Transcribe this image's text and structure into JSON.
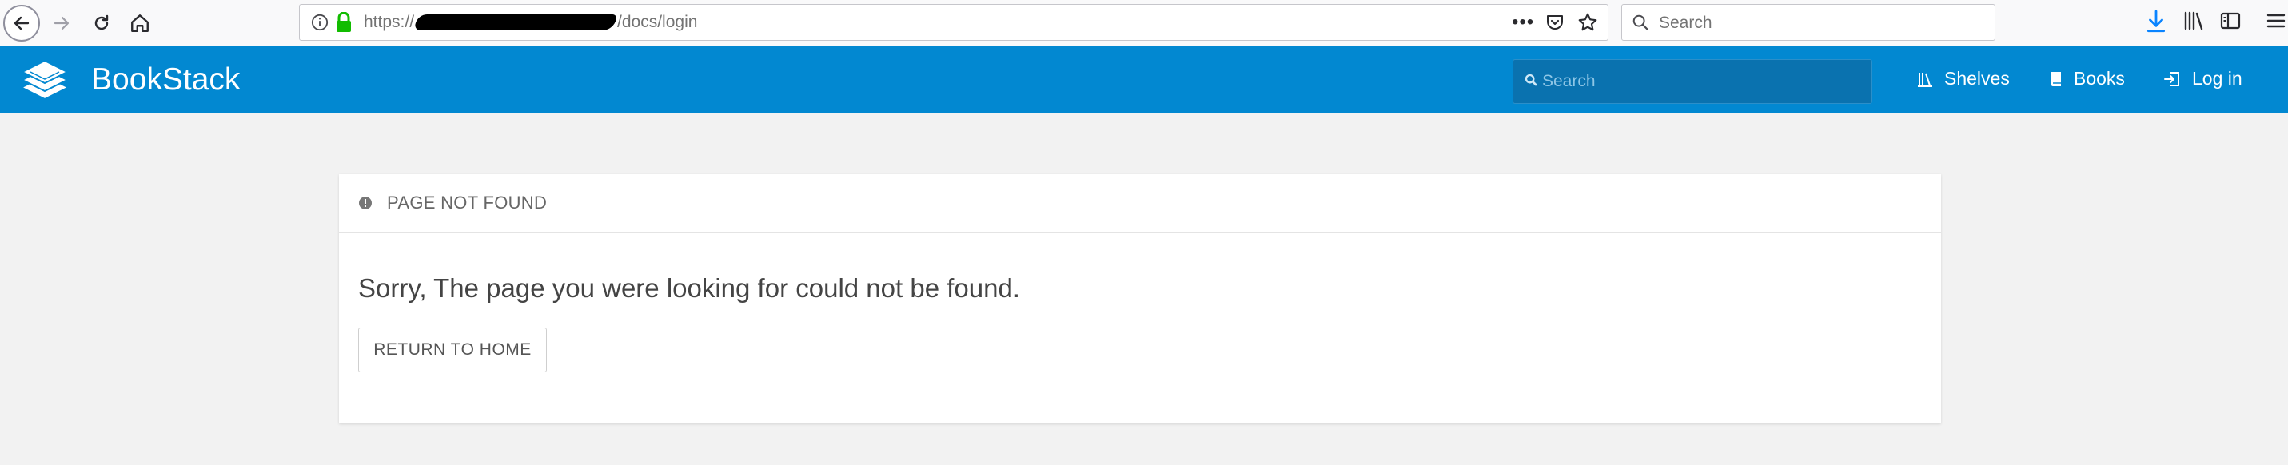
{
  "browser": {
    "url_prefix": "https://",
    "url_path": "/docs/login",
    "search_placeholder": "Search"
  },
  "app": {
    "brand": "BookStack",
    "search_placeholder": "Search",
    "nav": [
      {
        "label": "Shelves",
        "icon": "shelves-icon"
      },
      {
        "label": "Books",
        "icon": "book-icon"
      },
      {
        "label": "Log in",
        "icon": "login-icon"
      }
    ],
    "accent_color": "#0288d1"
  },
  "error": {
    "title": "PAGE NOT FOUND",
    "message": "Sorry, The page you were looking for could not be found.",
    "button": "RETURN TO HOME"
  }
}
